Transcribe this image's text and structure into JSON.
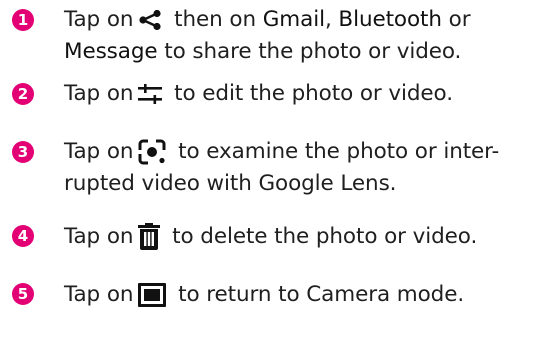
{
  "steps": [
    {
      "number": "1",
      "before": "Tap on",
      "icon": "share-icon",
      "after_lead": " then on ",
      "opt1": "Gmail",
      "sep1": ", ",
      "opt2": "Bluetooth",
      "sep2": " or",
      "line2_opt3": "Message",
      "line2_rest": " to share the photo or video."
    },
    {
      "number": "2",
      "before": "Tap on",
      "icon": "edit-sliders-icon",
      "after": " to edit the photo or video."
    },
    {
      "number": "3",
      "before": "Tap on",
      "icon": "google-lens-icon",
      "after": " to examine the photo or inter-",
      "line2": "rupted video with Google Lens."
    },
    {
      "number": "4",
      "before": "Tap on",
      "icon": "trash-icon",
      "after": " to delete the photo or video."
    },
    {
      "number": "5",
      "before": "Tap on",
      "icon": "camera-mode-icon",
      "after": " to return to Camera mode."
    }
  ],
  "colors": {
    "badge": "#e20074",
    "text": "#1f1f1f"
  }
}
